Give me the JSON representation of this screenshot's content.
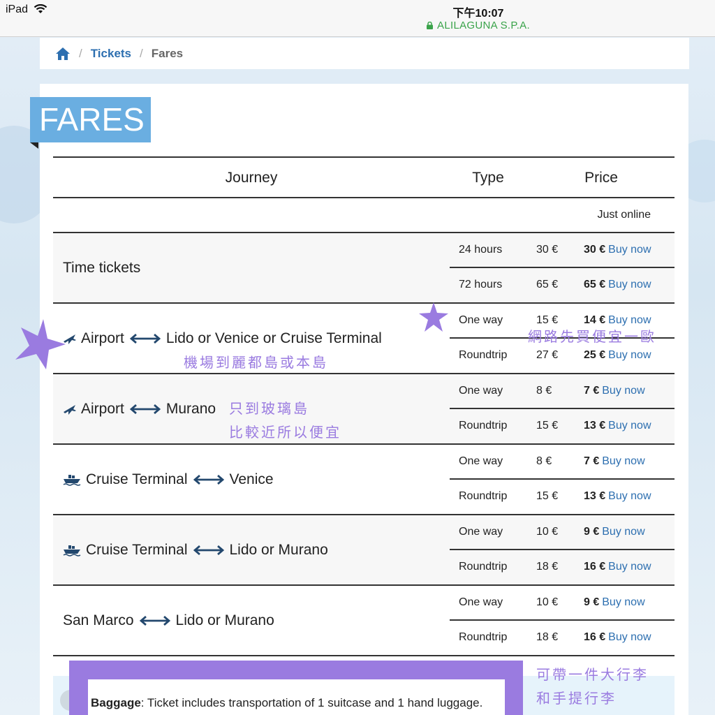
{
  "status_bar": {
    "device": "iPad",
    "time": "下午10:07",
    "site": "ALILAGUNA S.P.A."
  },
  "breadcrumb": {
    "items": [
      "Tickets",
      "Fares"
    ],
    "separator": "/"
  },
  "page_title": "FARES",
  "table": {
    "headers": {
      "journey": "Journey",
      "type": "Type",
      "price": "Price"
    },
    "online_label": "Just online",
    "buy_label": "Buy now",
    "groups": [
      {
        "from": "Time tickets",
        "to": "",
        "rows": [
          {
            "type": "24 hours",
            "price": "30 €",
            "online": "30 €"
          },
          {
            "type": "72 hours",
            "price": "65 €",
            "online": "65 €"
          }
        ]
      },
      {
        "from": "Airport",
        "to": "Lido or Venice or Cruise Terminal",
        "rows": [
          {
            "type": "One way",
            "price": "15 €",
            "online": "14 €"
          },
          {
            "type": "Roundtrip",
            "price": "27 €",
            "online": "25 €"
          }
        ]
      },
      {
        "from": "Airport",
        "to": "Murano",
        "rows": [
          {
            "type": "One way",
            "price": "8 €",
            "online": "7 €"
          },
          {
            "type": "Roundtrip",
            "price": "15 €",
            "online": "13 €"
          }
        ]
      },
      {
        "from": "Cruise Terminal",
        "to": "Venice",
        "rows": [
          {
            "type": "One way",
            "price": "8 €",
            "online": "7 €"
          },
          {
            "type": "Roundtrip",
            "price": "15 €",
            "online": "13 €"
          }
        ]
      },
      {
        "from": "Cruise Terminal",
        "to": "Lido or Murano",
        "rows": [
          {
            "type": "One way",
            "price": "10 €",
            "online": "9 €"
          },
          {
            "type": "Roundtrip",
            "price": "18 €",
            "online": "16 €"
          }
        ]
      },
      {
        "from": "San Marco",
        "to": "Lido or Murano",
        "rows": [
          {
            "type": "One way",
            "price": "10 €",
            "online": "9 €"
          },
          {
            "type": "Roundtrip",
            "price": "18 €",
            "online": "16 €"
          }
        ]
      }
    ]
  },
  "baggage": {
    "label": "Baggage",
    "text": ": Ticket includes transportation of 1 suitcase and 1 hand luggage."
  },
  "annotations": {
    "online_cheaper": "網路先買便宜一歐",
    "airport_lido": "機場到麗都島或本島",
    "murano_line1": "只到玻璃島",
    "murano_line2": "比較近所以便宜",
    "baggage_line1": "可帶一件大行李",
    "baggage_line2": "和手提行李"
  },
  "colors": {
    "accent": "#6aaee1",
    "link": "#2d6fb0",
    "annotation": "#9a7be0",
    "secure": "#3aa34a"
  }
}
